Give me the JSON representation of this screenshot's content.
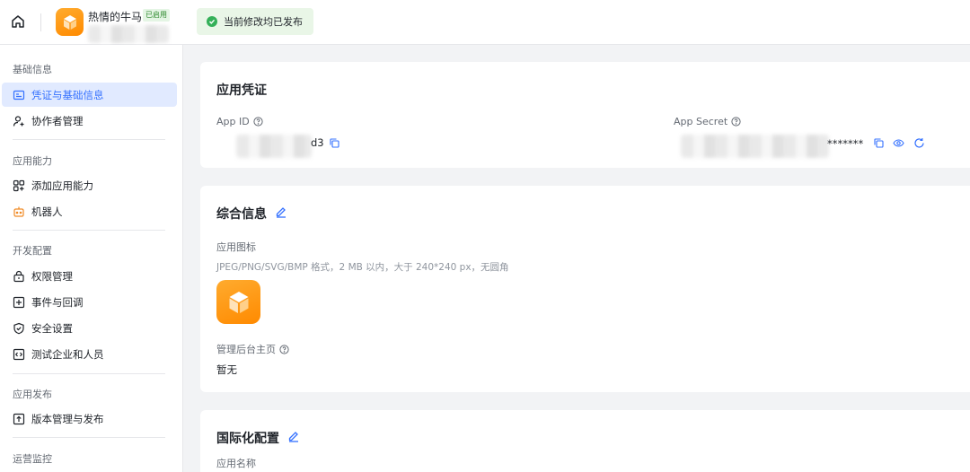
{
  "header": {
    "app_name": "热情的牛马",
    "app_badge": "已启用",
    "toast": "当前修改均已发布"
  },
  "sidebar": {
    "sections": [
      {
        "title": "基础信息",
        "items": [
          {
            "label": "凭证与基础信息",
            "icon": "credential-icon",
            "active": true
          },
          {
            "label": "协作者管理",
            "icon": "user-add-icon"
          }
        ]
      },
      {
        "title": "应用能力",
        "items": [
          {
            "label": "添加应用能力",
            "icon": "grid-plus-icon"
          },
          {
            "label": "机器人",
            "icon": "robot-icon"
          }
        ]
      },
      {
        "title": "开发配置",
        "items": [
          {
            "label": "权限管理",
            "icon": "lock-icon"
          },
          {
            "label": "事件与回调",
            "icon": "event-icon"
          },
          {
            "label": "安全设置",
            "icon": "shield-icon"
          },
          {
            "label": "测试企业和人员",
            "icon": "code-icon"
          }
        ]
      },
      {
        "title": "应用发布",
        "items": [
          {
            "label": "版本管理与发布",
            "icon": "upload-icon"
          }
        ]
      },
      {
        "title": "运营监控",
        "items": []
      }
    ]
  },
  "credentials": {
    "title": "应用凭证",
    "app_id_label": "App ID",
    "app_id_value": "d3",
    "app_secret_label": "App Secret",
    "app_secret_value": "*******"
  },
  "general": {
    "title": "综合信息",
    "icon_label": "应用图标",
    "icon_hint": "JPEG/PNG/SVG/BMP 格式，2 MB 以内，大于 240*240 px，无圆角",
    "homepage_label": "管理后台主页",
    "homepage_value": "暂无"
  },
  "i18n": {
    "title": "国际化配置",
    "app_name_label": "应用名称"
  },
  "colors": {
    "accent": "#3370ff",
    "brand_orange": "#ff8a00",
    "success": "#34b058"
  }
}
